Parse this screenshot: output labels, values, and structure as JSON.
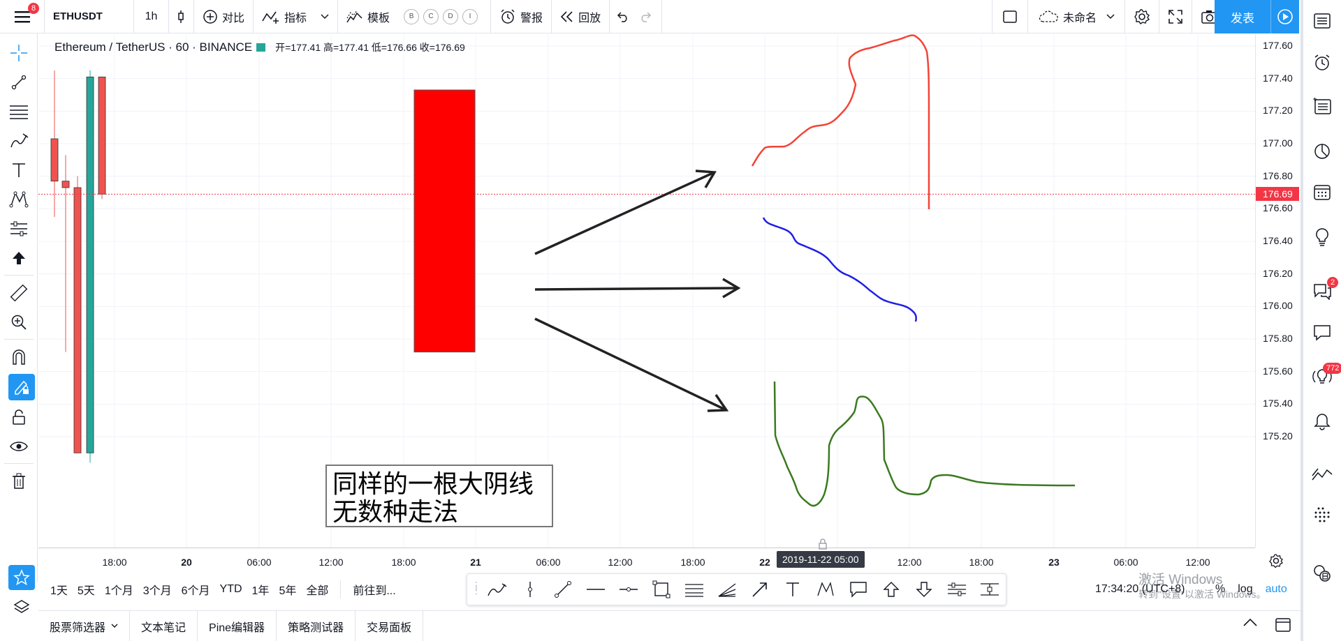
{
  "topbar": {
    "menu_badge": "8",
    "symbol": "ETHUSDT",
    "interval": "1h",
    "compare": "对比",
    "indicators": "指标",
    "templates": "模板",
    "pills": [
      "B",
      "C",
      "D",
      "I"
    ],
    "alert": "警报",
    "replay": "回放",
    "layout_name": "未命名",
    "publish": "发表"
  },
  "legend": {
    "title": "Ethereum / TetherUS · 60 · BINANCE",
    "ohlc": "开=177.41  高=177.41  低=176.66  收=176.69"
  },
  "annotation": {
    "line1": "同样的一根大阴线",
    "line2": "无数种走法"
  },
  "chart_data": {
    "type": "candlestick",
    "symbol": "ETHUSDT",
    "exchange": "BINANCE",
    "interval": "60",
    "ylim": [
      175.15,
      177.7
    ],
    "current_price": 176.69,
    "candles": [
      {
        "o": 177.03,
        "h": 177.45,
        "l": 176.55,
        "c": 176.77
      },
      {
        "o": 176.77,
        "h": 176.93,
        "l": 175.72,
        "c": 176.73
      },
      {
        "o": 176.73,
        "h": 176.8,
        "l": 175.34,
        "c": 175.1
      },
      {
        "o": 175.1,
        "h": 177.45,
        "l": 175.04,
        "c": 177.41
      },
      {
        "o": 177.41,
        "h": 177.41,
        "l": 176.66,
        "c": 176.69
      }
    ],
    "big_candle": {
      "o": 177.33,
      "c": 175.72
    },
    "scenario_colors": {
      "up": "#f44336",
      "down": "#1e1ee6",
      "range": "#3a7a1f"
    }
  },
  "price_axis": {
    "labels": [
      "177.60",
      "177.40",
      "177.20",
      "177.00",
      "176.80",
      "176.60",
      "176.40",
      "176.20",
      "176.00",
      "175.80",
      "175.60",
      "175.40",
      "175.20"
    ],
    "current": "176.69"
  },
  "time_axis": {
    "labels": [
      "18:00",
      "20",
      "06:00",
      "12:00",
      "18:00",
      "21",
      "06:00",
      "12:00",
      "18:00",
      "22",
      "06:00",
      "12:00",
      "18:00",
      "23",
      "06:00",
      "12:00"
    ],
    "cursor": "2019-11-22   05:00"
  },
  "rangebar": {
    "ranges": [
      "1天",
      "5天",
      "1个月",
      "3个月",
      "6个月",
      "YTD",
      "1年",
      "5年",
      "全部"
    ],
    "goto": "前往到..."
  },
  "clock": "17:34:20 (UTC+8)",
  "axis_opts": {
    "pct": "%",
    "log": "log",
    "auto": "auto"
  },
  "watermark": {
    "line1": "激活 Windows",
    "line2": "转到\"设置\"以激活 Windows。"
  },
  "bottom_tabs": [
    "股票筛选器",
    "文本笔记",
    "Pine编辑器",
    "策略测试器",
    "交易面板"
  ],
  "right_badges": {
    "chat": "2",
    "ideas": "772"
  }
}
